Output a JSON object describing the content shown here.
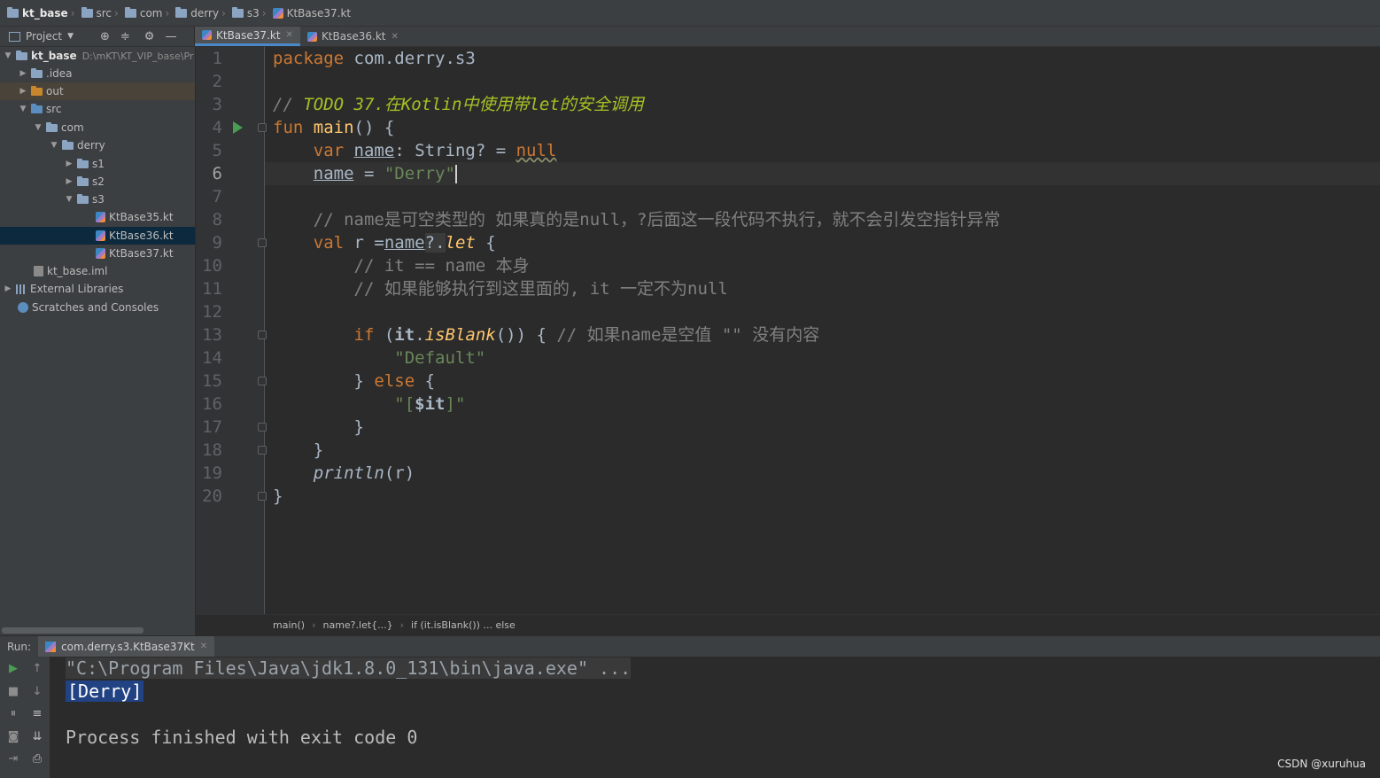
{
  "navbar": {
    "crumbs": [
      "kt_base",
      "src",
      "com",
      "derry",
      "s3",
      "KtBase37.kt"
    ]
  },
  "toolbar": {
    "project_label": "Project",
    "tabs": [
      {
        "label": "KtBase37.kt",
        "active": true
      },
      {
        "label": "KtBase36.kt",
        "active": false
      }
    ]
  },
  "sidebar": {
    "root": {
      "label": "kt_base",
      "path": "D:\\mKT\\KT_VIP_base\\Pr"
    },
    "items": [
      {
        "label": ".idea"
      },
      {
        "label": "out"
      },
      {
        "label": "src"
      },
      {
        "label": "com"
      },
      {
        "label": "derry"
      },
      {
        "label": "s1"
      },
      {
        "label": "s2"
      },
      {
        "label": "s3"
      },
      {
        "label": "KtBase35.kt"
      },
      {
        "label": "KtBase36.kt"
      },
      {
        "label": "KtBase37.kt"
      },
      {
        "label": "kt_base.iml"
      },
      {
        "label": "External Libraries"
      },
      {
        "label": "Scratches and Consoles"
      }
    ]
  },
  "editor": {
    "line_numbers": [
      "1",
      "2",
      "3",
      "4",
      "5",
      "6",
      "7",
      "8",
      "9",
      "10",
      "11",
      "12",
      "13",
      "14",
      "15",
      "16",
      "17",
      "18",
      "19",
      "20"
    ],
    "current_line": 6,
    "code": {
      "l1_kw": "package",
      "l1_rest": " com.derry.s3",
      "l3_cmt": "// ",
      "l3_todo": "TODO 37.在Kotlin中使用带let的安全调用",
      "l4_kw": "fun",
      "l4_fn": "main",
      "l4_rest": "() {",
      "l5_kw": "var",
      "l5_name": "name",
      "l5_mid": ": String? = ",
      "l5_null": "null",
      "l6_name": "name",
      "l6_eq": " = ",
      "l6_str": "\"Derry\"",
      "l8_cmt": "// name是可空类型的 如果真的是null，?后面这一段代码不执行，就不会引发空指针异常",
      "l9_kw": "val",
      "l9_mid": " r =",
      "l9_name": "name",
      "l9_safe": "?.",
      "l9_let": "let",
      "l9_end": " {",
      "l10_cmt": "// it == name 本身",
      "l11_cmt": "// 如果能够执行到这里面的, it 一定不为null",
      "l13_kw": "if",
      "l13_a": " (",
      "l13_it": "it",
      "l13_dot": ".",
      "l13_fn": "isBlank",
      "l13_b": "()) { ",
      "l13_cmt": "// 如果name是空值 \"\" 没有内容",
      "l14_str": "\"Default\"",
      "l15_a": "} ",
      "l15_kw": "else",
      "l15_b": " {",
      "l16_s1": "\"[",
      "l16_it": "$it",
      "l16_s2": "]\"",
      "l17": "}",
      "l18": "}",
      "l19_fn": "println",
      "l19_rest": "(r)",
      "l20": "}"
    }
  },
  "editor_breadcrumbs": [
    "main()",
    "name?.let{...}",
    "if (it.isBlank()) ... else"
  ],
  "run": {
    "label": "Run:",
    "tab": "com.derry.s3.KtBase37Kt",
    "console": [
      "\"C:\\Program Files\\Java\\jdk1.8.0_131\\bin\\java.exe\" ...",
      "[Derry]",
      "",
      "Process finished with exit code 0"
    ]
  },
  "watermark": "CSDN @xuruhua"
}
